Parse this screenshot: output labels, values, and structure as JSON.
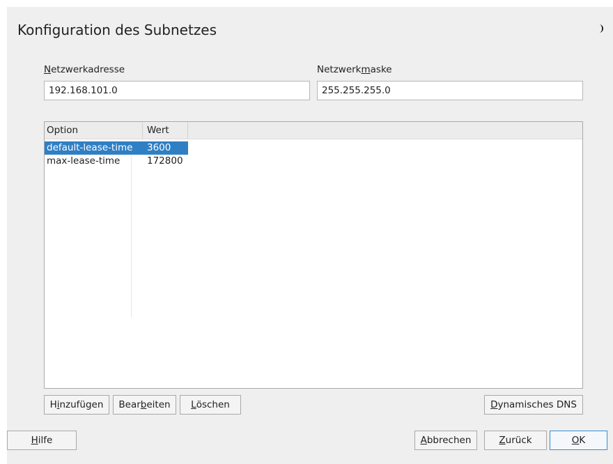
{
  "dialog": {
    "title": "Konfiguration des Subnetzes"
  },
  "network": {
    "address_label_pre": "",
    "address_label_key": "N",
    "address_label_post": "etzwerkadresse",
    "address_value": "192.168.101.0",
    "mask_label_pre": "Netzwerk",
    "mask_label_key": "m",
    "mask_label_post": "aske",
    "mask_value": "255.255.255.0"
  },
  "table": {
    "columns": [
      "Option",
      "Wert"
    ],
    "rows": [
      {
        "option": "default-lease-time",
        "value": "3600",
        "selected": true
      },
      {
        "option": "max-lease-time",
        "value": "172800",
        "selected": false
      }
    ]
  },
  "buttons": {
    "add": {
      "pre": "H",
      "key": "i",
      "post": "nzufügen"
    },
    "edit": {
      "pre": "Bear",
      "key": "b",
      "post": "eiten"
    },
    "delete": {
      "pre": "",
      "key": "L",
      "post": "öschen"
    },
    "ddns": {
      "pre": "",
      "key": "D",
      "post": "ynamisches DNS"
    },
    "help": {
      "pre": "",
      "key": "H",
      "post": "ilfe"
    },
    "cancel": {
      "pre": "",
      "key": "A",
      "post": "bbrechen"
    },
    "back": {
      "pre": "",
      "key": "Z",
      "post": "urück"
    },
    "ok": {
      "pre": "",
      "key": "O",
      "post": "K"
    }
  },
  "colors": {
    "selection": "#2f7fc4",
    "background": "#efefef",
    "ok_border": "#3b8ad0"
  },
  "icons": {
    "theme": "moon-icon"
  }
}
